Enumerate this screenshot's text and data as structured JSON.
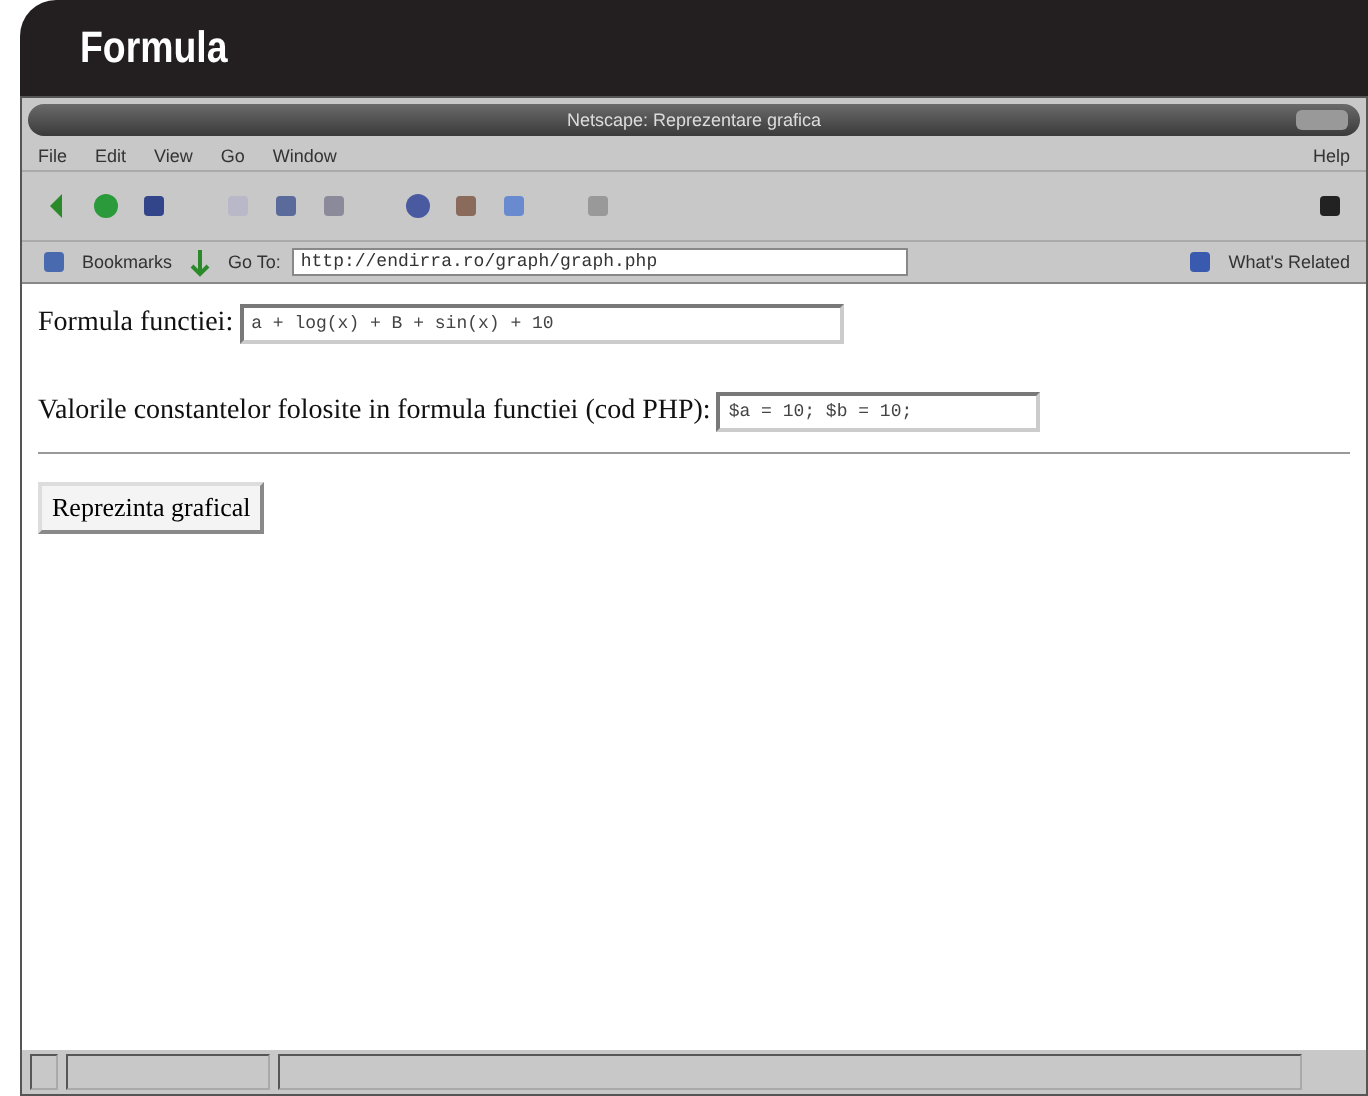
{
  "header": {
    "title": "Formula"
  },
  "window": {
    "title": "Netscape: Reprezentare grafica"
  },
  "menu": {
    "items": [
      "File",
      "Edit",
      "View",
      "Go",
      "Window"
    ],
    "help": "Help"
  },
  "location_bar": {
    "bookmarks": "Bookmarks",
    "go_to": "Go To:",
    "url": "http://endirra.ro/graph/graph.php",
    "related": "What's Related"
  },
  "form": {
    "fields": [
      {
        "label": "Formula functiei:",
        "value": "a + log(x) + B + sin(x) + 10"
      },
      {
        "label": "Valorile constantelor folosite in formula functiei (cod PHP):",
        "value": "$a = 10; $b = 10;"
      }
    ],
    "button": "Reprezinta grafical"
  }
}
